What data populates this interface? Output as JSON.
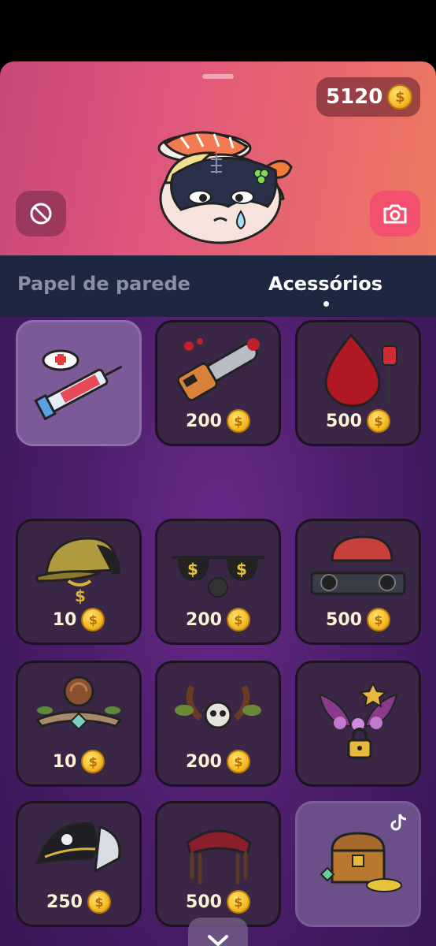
{
  "header": {
    "coin_balance": "5120"
  },
  "hero": {
    "clear_icon": "prohibited-icon",
    "camera_icon": "camera-icon"
  },
  "tabs": [
    {
      "label": "Papel de parede",
      "active": false
    },
    {
      "label": "Acessórios",
      "active": true
    }
  ],
  "items": [
    {
      "name": "nurse-syringe",
      "price": "",
      "selected": true
    },
    {
      "name": "bloody-chainsaw",
      "price": "200"
    },
    {
      "name": "blood-drip",
      "price": "500"
    },
    {
      "name": "gold-cap-chain",
      "price": "10"
    },
    {
      "name": "dollar-sunglasses",
      "price": "200"
    },
    {
      "name": "dj-deck-cap",
      "price": "500"
    },
    {
      "name": "forest-crown",
      "price": "10"
    },
    {
      "name": "skull-horns",
      "price": "200"
    },
    {
      "name": "fairy-flower-crown",
      "price": "",
      "locked": true
    },
    {
      "name": "pirate-hat",
      "price": "250"
    },
    {
      "name": "dreadlocks-bandana",
      "price": "500"
    },
    {
      "name": "treasure-chest",
      "price": "",
      "special": true
    }
  ],
  "colors": {
    "hero_start": "#c8487a",
    "hero_end": "#ee7a60",
    "camera_button": "#f2506e",
    "tabs_bg": "#1e2740",
    "card_bg": "#3a2746",
    "coin": "#f5bd2a"
  },
  "footer": {
    "collapse_icon": "chevron-down-icon"
  }
}
